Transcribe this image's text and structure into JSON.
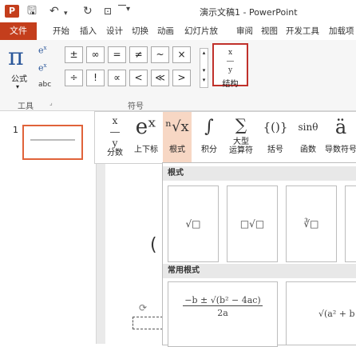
{
  "window": {
    "title": "演示文稿1 - PowerPoint",
    "logo_text": "P"
  },
  "tabs": {
    "file": "文件",
    "items": [
      "开始",
      "插入",
      "设计",
      "切换",
      "动画",
      "幻灯片放",
      "审阅",
      "视图",
      "开发工具",
      "加载项"
    ]
  },
  "ribbon": {
    "equation_label": "公式",
    "tools_group": "工具",
    "symbols_group": "符号",
    "structure_label": "结构",
    "symbols": [
      "±",
      "∞",
      "=",
      "≠",
      "~",
      "×",
      "÷",
      "!",
      "∝",
      "<",
      "≪",
      ">"
    ]
  },
  "slides_pane": {
    "slide_number": "1"
  },
  "structures": [
    {
      "symbol": "x/y",
      "label": "分数"
    },
    {
      "symbol": "eˣ",
      "label": "上下标"
    },
    {
      "symbol": "ⁿ√x",
      "label": "根式"
    },
    {
      "symbol": "∫",
      "label": "积分"
    },
    {
      "symbol": "∑",
      "label": "大型\n运算符"
    },
    {
      "symbol": "{()}",
      "label": "括号"
    },
    {
      "symbol": "sinθ",
      "label": "函数"
    },
    {
      "symbol": "ä",
      "label": "导数符号"
    }
  ],
  "dropdown": {
    "section1": "根式",
    "section2": "常用根式",
    "radicals": [
      "√□",
      "□√□",
      "∛□"
    ],
    "formula": {
      "numerator": "−b ± √(b² − 4ac)",
      "denominator": "2a"
    },
    "formula2": "√(a² + b"
  }
}
